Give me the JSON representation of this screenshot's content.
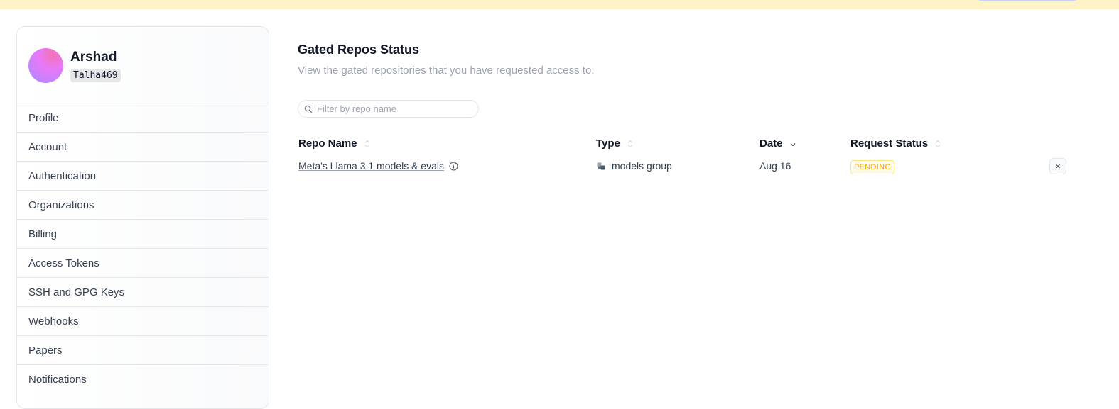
{
  "user": {
    "name": "Arshad",
    "handle": "Talha469"
  },
  "sidebar": {
    "items": [
      {
        "label": "Profile"
      },
      {
        "label": "Account"
      },
      {
        "label": "Authentication"
      },
      {
        "label": "Organizations"
      },
      {
        "label": "Billing"
      },
      {
        "label": "Access Tokens"
      },
      {
        "label": "SSH and GPG Keys"
      },
      {
        "label": "Webhooks"
      },
      {
        "label": "Papers"
      },
      {
        "label": "Notifications"
      }
    ]
  },
  "main": {
    "title": "Gated Repos Status",
    "subtitle": "View the gated repositories that you have requested access to.",
    "filter": {
      "placeholder": "Filter by repo name",
      "value": ""
    },
    "table": {
      "columns": [
        "Repo Name",
        "Type",
        "Date",
        "Request Status"
      ],
      "rows": [
        {
          "repo_name": "Meta's Llama 3.1 models & evals",
          "type": "models group",
          "date": "Aug 16",
          "status": "PENDING"
        }
      ],
      "remove_label": "×"
    }
  },
  "icons": {
    "filter": "search-icon",
    "info": "info-icon",
    "type": "cubes-icon",
    "sort": "sort-icon",
    "sort_active": "chevron-down-icon"
  },
  "colors": {
    "banner": "#fef3c7",
    "pending": "#f59e0b"
  }
}
